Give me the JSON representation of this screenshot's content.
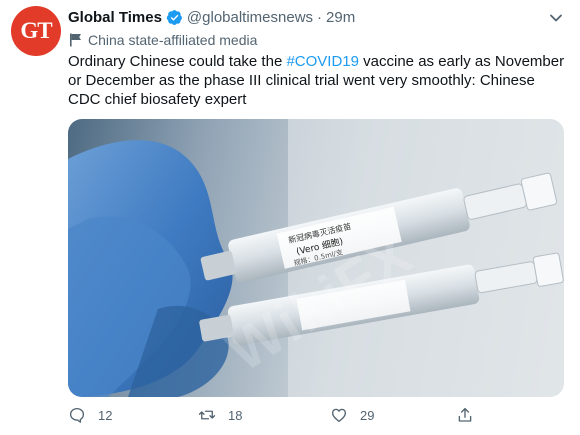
{
  "author": {
    "avatar_text": "GT",
    "name": "Global Times",
    "handle": "@globaltimesnews",
    "separator": "·",
    "time": "29m"
  },
  "affiliation": {
    "label": "China state-affiliated media"
  },
  "tweet": {
    "text_before": "Ordinary Chinese could take the ",
    "hashtag": "#COVID19",
    "text_after": " vaccine as early as November or December as the phase III clinical trial went very smoothly: Chinese CDC chief biosafety expert"
  },
  "media": {
    "watermark": "WikiFX",
    "syringe1_label_line1": "新冠病毒灭活疫苗",
    "syringe1_label_line2": "(Vero 细胞)",
    "syringe1_label_line3": "规格：0.5ml/支"
  },
  "actions": {
    "replies": "12",
    "retweets": "18",
    "likes": "29"
  },
  "colors": {
    "accent": "#1d9bf0",
    "avatar_bg": "#e23b29",
    "muted": "#536471"
  }
}
